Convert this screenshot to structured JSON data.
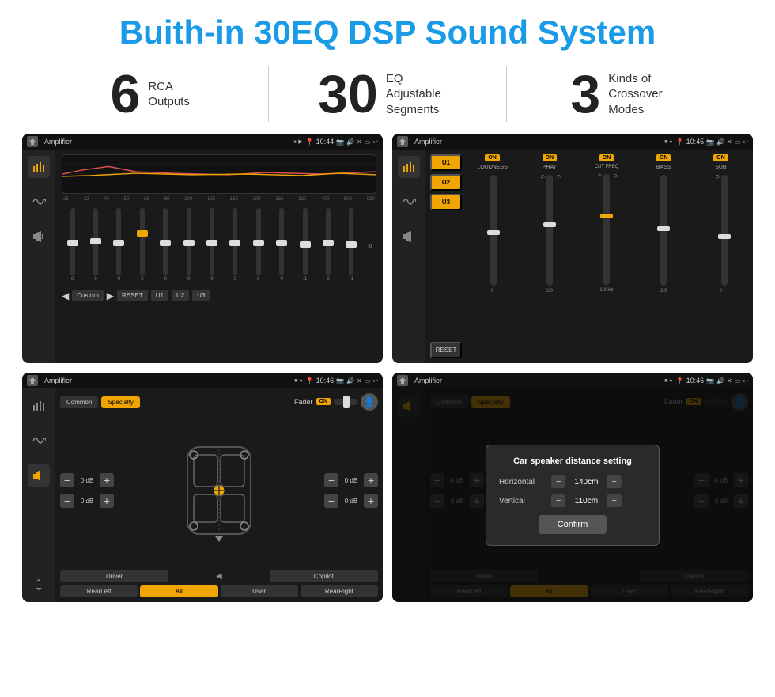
{
  "page": {
    "title": "Buith-in 30EQ DSP Sound System",
    "stats": [
      {
        "number": "6",
        "label": "RCA\nOutputs"
      },
      {
        "number": "30",
        "label": "EQ Adjustable\nSegments"
      },
      {
        "number": "3",
        "label": "Kinds of\nCrossover Modes"
      }
    ]
  },
  "screen1": {
    "title": "Amplifier",
    "time": "10:44",
    "freqs": [
      "25",
      "32",
      "40",
      "50",
      "63",
      "80",
      "100",
      "125",
      "160",
      "200",
      "250",
      "320",
      "400",
      "500",
      "630"
    ],
    "values": [
      "0",
      "0",
      "0",
      "5",
      "0",
      "0",
      "0",
      "0",
      "0",
      "0",
      "0",
      "-1",
      "0",
      "-1"
    ],
    "buttons": [
      "Custom",
      "RESET",
      "U1",
      "U2",
      "U3"
    ]
  },
  "screen2": {
    "title": "Amplifier",
    "time": "10:45",
    "presets": [
      "U1",
      "U2",
      "U3"
    ],
    "controls": [
      "LOUDNESS",
      "PHAT",
      "CUT FREQ",
      "BASS",
      "SUB"
    ],
    "resetLabel": "RESET"
  },
  "screen3": {
    "title": "Amplifier",
    "time": "10:46",
    "tabs": [
      "Common",
      "Specialty"
    ],
    "faderLabel": "Fader",
    "faderOn": "ON",
    "dBValues": [
      "0 dB",
      "0 dB",
      "0 dB",
      "0 dB"
    ],
    "buttons": [
      "Driver",
      "RearLeft",
      "All",
      "User",
      "RearRight",
      "Copilot"
    ]
  },
  "screen4": {
    "title": "Amplifier",
    "time": "10:46",
    "tabs": [
      "Common",
      "Specialty"
    ],
    "dialog": {
      "title": "Car speaker distance setting",
      "horizontal_label": "Horizontal",
      "horizontal_value": "140cm",
      "vertical_label": "Vertical",
      "vertical_value": "110cm",
      "confirm_label": "Confirm"
    },
    "dBValues": [
      "0 dB",
      "0 dB"
    ],
    "buttons": [
      "Driver",
      "RearLeft",
      "All",
      "User",
      "RearRight",
      "Copilot"
    ]
  }
}
